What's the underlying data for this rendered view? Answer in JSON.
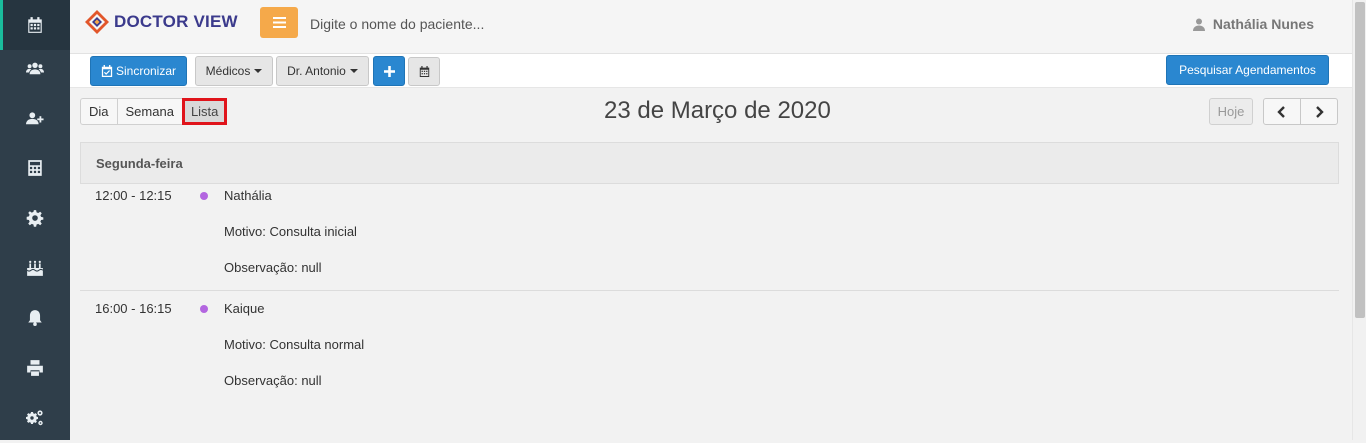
{
  "app": {
    "logo_text": "DOCTOR VIEW"
  },
  "search": {
    "placeholder": "Digite o nome do paciente..."
  },
  "user": {
    "name": "Nathália Nunes"
  },
  "sidebar": {
    "items": [
      {
        "icon": "calendar-icon",
        "active": true
      },
      {
        "icon": "users-icon",
        "active": false
      },
      {
        "icon": "user-plus-icon",
        "active": false
      },
      {
        "icon": "calculator-icon",
        "active": false
      },
      {
        "icon": "gear-icon",
        "active": false
      },
      {
        "icon": "birthday-cake-icon",
        "active": false
      },
      {
        "icon": "bell-icon",
        "active": false
      },
      {
        "icon": "print-icon",
        "active": false
      },
      {
        "icon": "gears-icon",
        "active": false
      }
    ]
  },
  "toolbar": {
    "sync_label": "Sincronizar",
    "doctors_label": "Médicos",
    "doctor_selected": "Dr. Antonio",
    "add_icon": "plus-icon",
    "calendar_icon": "calendar-icon",
    "search_appointments_label": "Pesquisar Agendamentos"
  },
  "calendar": {
    "views": {
      "day": "Dia",
      "week": "Semana",
      "list": "Lista"
    },
    "active_view": "Lista",
    "title": "23 de Março de 2020",
    "today_label": "Hoje",
    "prev_icon": "chevron-left-icon",
    "next_icon": "chevron-right-icon"
  },
  "list": {
    "day_label": "Segunda-feira",
    "events": [
      {
        "time": "12:00 - 12:15",
        "patient": "Nathália",
        "reason": "Motivo: Consulta inicial",
        "observation": "Observação: null",
        "dot_color": "#b366e0"
      },
      {
        "time": "16:00 - 16:15",
        "patient": "Kaique",
        "reason": "Motivo: Consulta normal",
        "observation": "Observação: null",
        "dot_color": "#b366e0"
      }
    ]
  },
  "colors": {
    "sidebar_bg": "#2f3e4a",
    "primary": "#2a87d0",
    "accent_orange": "#f5a94a",
    "highlight": "#e0141b",
    "active_marker": "#1abc9c"
  }
}
